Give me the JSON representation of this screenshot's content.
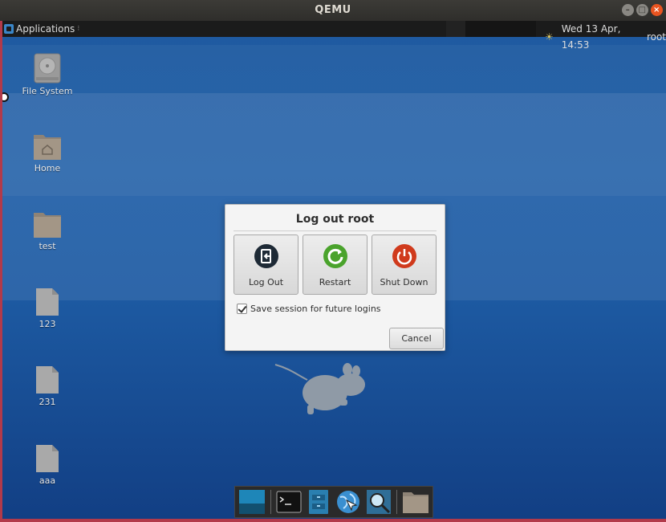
{
  "host_window": {
    "title": "QEMU",
    "buttons": [
      "minimize",
      "maximize",
      "close"
    ]
  },
  "panel": {
    "applications_label": "Applications",
    "datetime": "Wed 13 Apr, 14:53",
    "user": "root",
    "tray_icon": "weather-icon"
  },
  "desktop_icons": [
    {
      "label": "File System",
      "icon": "drive-icon"
    },
    {
      "label": "Home",
      "icon": "home-folder-icon"
    },
    {
      "label": "test",
      "icon": "folder-icon"
    },
    {
      "label": "123",
      "icon": "file-icon"
    },
    {
      "label": "231",
      "icon": "file-icon"
    },
    {
      "label": "aaa",
      "icon": "file-icon"
    }
  ],
  "dialog": {
    "title": "Log out root",
    "actions": [
      {
        "label": "Log Out",
        "icon": "logout-icon",
        "color": "#1e2a36"
      },
      {
        "label": "Restart",
        "icon": "restart-icon",
        "color": "#4aa32c"
      },
      {
        "label": "Shut Down",
        "icon": "power-icon",
        "color": "#d03a1c"
      }
    ],
    "save_session_label": "Save session for future logins",
    "save_session_checked": true,
    "cancel_label": "Cancel"
  },
  "dock": {
    "items": [
      "show-desktop-icon",
      "terminal-icon",
      "file-manager-icon",
      "web-browser-icon",
      "app-finder-icon",
      "folder-icon"
    ]
  },
  "colors": {
    "desktop": "#1e5ea7",
    "panel": "#1b1b1b",
    "accent_close": "#e95420"
  }
}
